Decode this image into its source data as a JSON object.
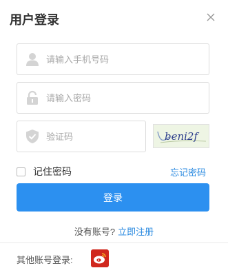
{
  "dialog": {
    "title": "用户登录",
    "close_icon": "close-icon"
  },
  "form": {
    "phone": {
      "placeholder": "请输入手机号码",
      "value": "",
      "icon": "user-icon"
    },
    "password": {
      "placeholder": "请输入密码",
      "value": "",
      "icon": "lock-icon"
    },
    "captcha": {
      "placeholder": "验证码",
      "value": "",
      "icon": "shield-icon",
      "image_text": "beni2f"
    },
    "remember_label": "记住密码",
    "remember_checked": false,
    "forgot_label": "忘记密码",
    "login_label": "登录"
  },
  "register": {
    "prompt": "没有账号?",
    "link": "立即注册"
  },
  "other": {
    "label": "其他账号登录:",
    "weibo_icon": "weibo-icon"
  },
  "colors": {
    "accent": "#2c90f0",
    "link": "#2a8ae0",
    "weibo": "#d0281e"
  }
}
